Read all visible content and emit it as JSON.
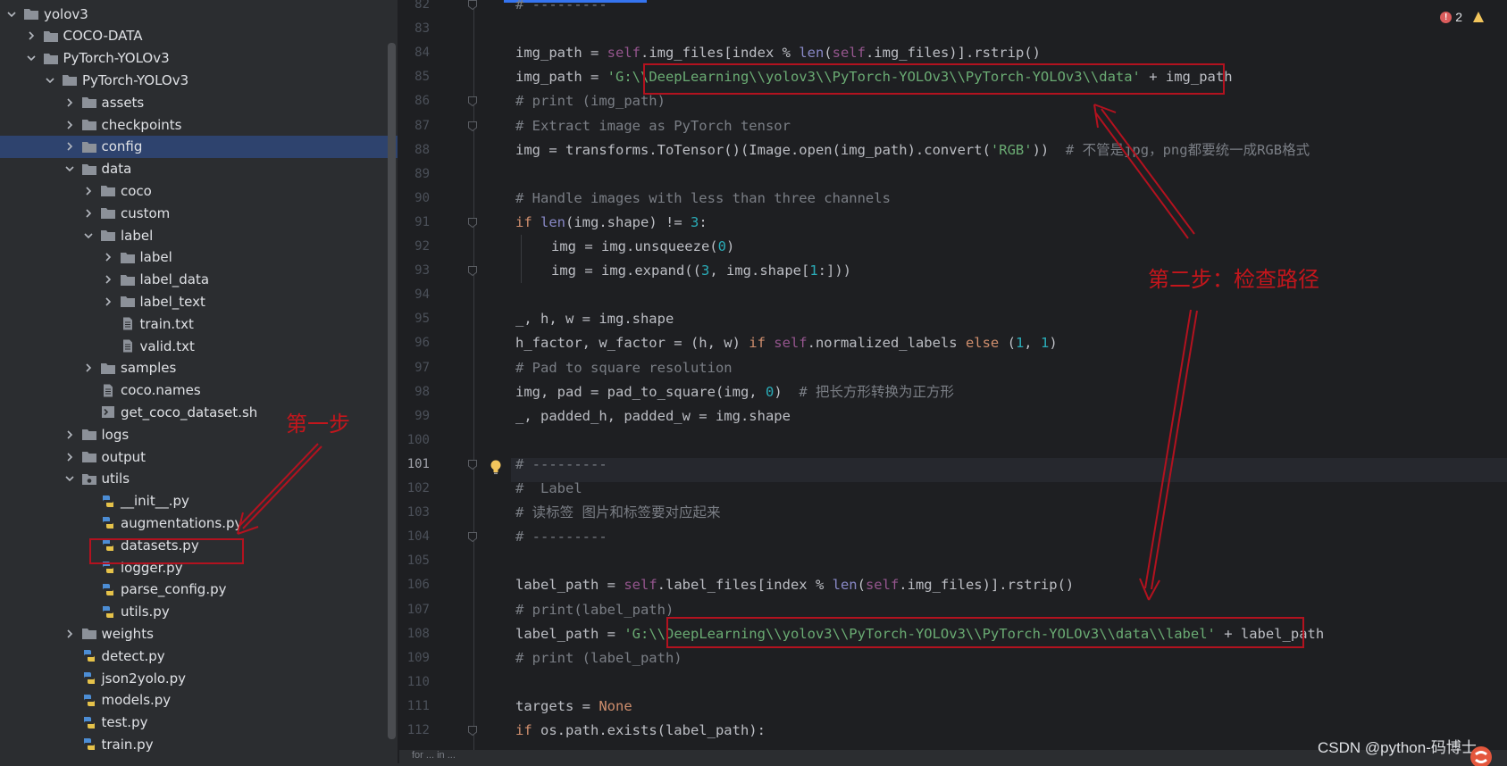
{
  "tree": {
    "items": [
      {
        "label": "yolov3",
        "icon": "folder-icon",
        "depth": 0,
        "arrow": "open"
      },
      {
        "label": "COCO-DATA",
        "icon": "folder-icon",
        "depth": 1,
        "arrow": "closed"
      },
      {
        "label": "PyTorch-YOLOv3",
        "icon": "folder-icon",
        "depth": 1,
        "arrow": "open"
      },
      {
        "label": "PyTorch-YOLOv3",
        "icon": "folder-icon",
        "depth": 2,
        "arrow": "open"
      },
      {
        "label": "assets",
        "icon": "folder-icon",
        "depth": 3,
        "arrow": "closed"
      },
      {
        "label": "checkpoints",
        "icon": "folder-icon",
        "depth": 3,
        "arrow": "closed"
      },
      {
        "label": "config",
        "icon": "folder-icon",
        "depth": 3,
        "arrow": "closed",
        "selected": true
      },
      {
        "label": "data",
        "icon": "folder-icon",
        "depth": 3,
        "arrow": "open"
      },
      {
        "label": "coco",
        "icon": "folder-icon",
        "depth": 4,
        "arrow": "closed"
      },
      {
        "label": "custom",
        "icon": "folder-icon",
        "depth": 4,
        "arrow": "closed"
      },
      {
        "label": "label",
        "icon": "folder-icon",
        "depth": 4,
        "arrow": "open"
      },
      {
        "label": "label",
        "icon": "folder-icon",
        "depth": 5,
        "arrow": "closed"
      },
      {
        "label": "label_data",
        "icon": "folder-icon",
        "depth": 5,
        "arrow": "closed"
      },
      {
        "label": "label_text",
        "icon": "folder-icon",
        "depth": 5,
        "arrow": "closed"
      },
      {
        "label": "train.txt",
        "icon": "text-file-icon",
        "depth": 5,
        "arrow": "none"
      },
      {
        "label": "valid.txt",
        "icon": "text-file-icon",
        "depth": 5,
        "arrow": "none"
      },
      {
        "label": "samples",
        "icon": "folder-icon",
        "depth": 4,
        "arrow": "closed"
      },
      {
        "label": "coco.names",
        "icon": "text-file-icon",
        "depth": 4,
        "arrow": "none"
      },
      {
        "label": "get_coco_dataset.sh",
        "icon": "shell-file-icon",
        "depth": 4,
        "arrow": "none"
      },
      {
        "label": "logs",
        "icon": "folder-icon",
        "depth": 3,
        "arrow": "closed"
      },
      {
        "label": "output",
        "icon": "folder-icon",
        "depth": 3,
        "arrow": "closed"
      },
      {
        "label": "utils",
        "icon": "package-folder-icon",
        "depth": 3,
        "arrow": "open"
      },
      {
        "label": "__init__.py",
        "icon": "python-file-icon",
        "depth": 4,
        "arrow": "none"
      },
      {
        "label": "augmentations.py",
        "icon": "python-file-icon",
        "depth": 4,
        "arrow": "none"
      },
      {
        "label": "datasets.py",
        "icon": "python-file-icon",
        "depth": 4,
        "arrow": "none"
      },
      {
        "label": "logger.py",
        "icon": "python-file-icon",
        "depth": 4,
        "arrow": "none"
      },
      {
        "label": "parse_config.py",
        "icon": "python-file-icon",
        "depth": 4,
        "arrow": "none"
      },
      {
        "label": "utils.py",
        "icon": "python-file-icon",
        "depth": 4,
        "arrow": "none"
      },
      {
        "label": "weights",
        "icon": "folder-icon",
        "depth": 3,
        "arrow": "closed"
      },
      {
        "label": "detect.py",
        "icon": "python-file-icon",
        "depth": 3,
        "arrow": "none"
      },
      {
        "label": "json2yolo.py",
        "icon": "python-file-icon",
        "depth": 3,
        "arrow": "none"
      },
      {
        "label": "models.py",
        "icon": "python-file-icon",
        "depth": 3,
        "arrow": "none"
      },
      {
        "label": "test.py",
        "icon": "python-file-icon",
        "depth": 3,
        "arrow": "none"
      },
      {
        "label": "train.py",
        "icon": "python-file-icon",
        "depth": 3,
        "arrow": "none"
      }
    ]
  },
  "editor": {
    "current_line": 101,
    "lines": [
      {
        "n": 82,
        "indent": 0,
        "tokens": [
          [
            "cm",
            "# ---------"
          ]
        ]
      },
      {
        "n": 83,
        "indent": 0,
        "tokens": []
      },
      {
        "n": 84,
        "indent": 0,
        "tokens": [
          [
            "pl",
            "img_path = "
          ],
          [
            "sf",
            "self"
          ],
          [
            "pl",
            ".img_files[index % "
          ],
          [
            "bi",
            "len"
          ],
          [
            "pl",
            "("
          ],
          [
            "sf",
            "self"
          ],
          [
            "pl",
            ".img_files)].rstrip()"
          ]
        ]
      },
      {
        "n": 85,
        "indent": 0,
        "tokens": [
          [
            "pl",
            "img_path = "
          ],
          [
            "st",
            "'G:\\\\DeepLearning\\\\yolov3\\\\PyTorch-YOLOv3\\\\PyTorch-YOLOv3\\\\data'"
          ],
          [
            "pl",
            " + img_path"
          ]
        ]
      },
      {
        "n": 86,
        "indent": 0,
        "tokens": [
          [
            "cm",
            "# print (img_path)"
          ]
        ]
      },
      {
        "n": 87,
        "indent": 0,
        "tokens": [
          [
            "cm",
            "# Extract image as PyTorch tensor"
          ]
        ]
      },
      {
        "n": 88,
        "indent": 0,
        "tokens": [
          [
            "pl",
            "img = transforms.ToTensor()(Image.open(img_path).convert("
          ],
          [
            "st",
            "'RGB'"
          ],
          [
            "pl",
            "))  "
          ],
          [
            "cm",
            "# 不管是jpg，png都要统一成RGB格式"
          ]
        ]
      },
      {
        "n": 89,
        "indent": 0,
        "tokens": []
      },
      {
        "n": 90,
        "indent": 0,
        "tokens": [
          [
            "cm",
            "# Handle images with less than three channels"
          ]
        ]
      },
      {
        "n": 91,
        "indent": 0,
        "tokens": [
          [
            "kw",
            "if "
          ],
          [
            "bi",
            "len"
          ],
          [
            "pl",
            "(img.shape) != "
          ],
          [
            "nm",
            "3"
          ],
          [
            "pl",
            ":"
          ]
        ]
      },
      {
        "n": 92,
        "indent": 1,
        "tokens": [
          [
            "pl",
            "img = img.unsqueeze("
          ],
          [
            "nm",
            "0"
          ],
          [
            "pl",
            ")"
          ]
        ]
      },
      {
        "n": 93,
        "indent": 1,
        "tokens": [
          [
            "pl",
            "img = img.expand(("
          ],
          [
            "nm",
            "3"
          ],
          [
            "pl",
            ", img.shape["
          ],
          [
            "nm",
            "1"
          ],
          [
            "pl",
            ":]))"
          ]
        ]
      },
      {
        "n": 94,
        "indent": 0,
        "tokens": []
      },
      {
        "n": 95,
        "indent": 0,
        "tokens": [
          [
            "pl",
            "_, h, w = img.shape"
          ]
        ]
      },
      {
        "n": 96,
        "indent": 0,
        "tokens": [
          [
            "pl",
            "h_factor, w_factor = (h, w) "
          ],
          [
            "kw",
            "if "
          ],
          [
            "sf",
            "self"
          ],
          [
            "pl",
            ".normalized_labels "
          ],
          [
            "kw",
            "else "
          ],
          [
            "pl",
            "("
          ],
          [
            "nm",
            "1"
          ],
          [
            "pl",
            ", "
          ],
          [
            "nm",
            "1"
          ],
          [
            "pl",
            ")"
          ]
        ]
      },
      {
        "n": 97,
        "indent": 0,
        "tokens": [
          [
            "cm",
            "# Pad to square resolution"
          ]
        ]
      },
      {
        "n": 98,
        "indent": 0,
        "tokens": [
          [
            "pl",
            "img, pad = pad_to_square(img, "
          ],
          [
            "nm",
            "0"
          ],
          [
            "pl",
            ")  "
          ],
          [
            "cm",
            "# 把长方形转换为正方形"
          ]
        ]
      },
      {
        "n": 99,
        "indent": 0,
        "tokens": [
          [
            "pl",
            "_, padded_h, padded_w = img.shape"
          ]
        ]
      },
      {
        "n": 100,
        "indent": 0,
        "tokens": []
      },
      {
        "n": 101,
        "indent": 0,
        "tokens": [
          [
            "cm",
            "# ---------"
          ]
        ]
      },
      {
        "n": 102,
        "indent": 0,
        "tokens": [
          [
            "cm",
            "#  Label"
          ]
        ]
      },
      {
        "n": 103,
        "indent": 0,
        "tokens": [
          [
            "cm",
            "# 读标签 图片和标签要对应起来"
          ]
        ]
      },
      {
        "n": 104,
        "indent": 0,
        "tokens": [
          [
            "cm",
            "# ---------"
          ]
        ]
      },
      {
        "n": 105,
        "indent": 0,
        "tokens": []
      },
      {
        "n": 106,
        "indent": 0,
        "tokens": [
          [
            "pl",
            "label_path = "
          ],
          [
            "sf",
            "self"
          ],
          [
            "pl",
            ".label_files[index % "
          ],
          [
            "bi",
            "len"
          ],
          [
            "pl",
            "("
          ],
          [
            "sf",
            "self"
          ],
          [
            "pl",
            ".img_files)].rstrip()"
          ]
        ]
      },
      {
        "n": 107,
        "indent": 0,
        "tokens": [
          [
            "cm",
            "# print(label_path)"
          ]
        ]
      },
      {
        "n": 108,
        "indent": 0,
        "tokens": [
          [
            "pl",
            "label_path = "
          ],
          [
            "st",
            "'G:\\\\DeepLearning\\\\yolov3\\\\PyTorch-YOLOv3\\\\PyTorch-YOLOv3\\\\data\\\\label'"
          ],
          [
            "pl",
            " + label_path"
          ]
        ]
      },
      {
        "n": 109,
        "indent": 0,
        "tokens": [
          [
            "cm",
            "# print (label_path)"
          ]
        ]
      },
      {
        "n": 110,
        "indent": 0,
        "tokens": []
      },
      {
        "n": 111,
        "indent": 0,
        "tokens": [
          [
            "pl",
            "targets = "
          ],
          [
            "kw",
            "None"
          ]
        ]
      },
      {
        "n": 112,
        "indent": 0,
        "tokens": [
          [
            "kw",
            "if "
          ],
          [
            "pl",
            "os.path.exists(label_path):"
          ]
        ]
      }
    ],
    "fold_marks": [
      82,
      86,
      87,
      91,
      93,
      101,
      104,
      112
    ],
    "error_count": "2",
    "bottom_text": "for ... in ..."
  },
  "annotations": {
    "step1": "第一步",
    "step2": "第二步：检查路径"
  },
  "watermark": "CSDN @python-码博士",
  "colors": {
    "annotation_red": "#b3121f",
    "selection": "#2e436e",
    "editor_bg": "#1e1f22",
    "sidebar_bg": "#2b2d30"
  }
}
